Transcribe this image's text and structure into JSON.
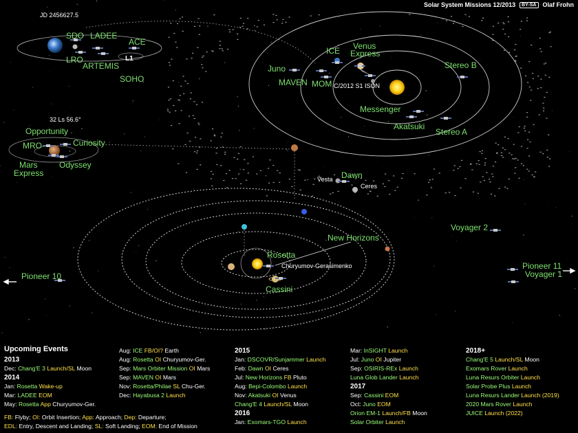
{
  "header": {
    "title": "Solar System Missions 12/2013",
    "license": "BY-SA",
    "author": "Olaf Frohn"
  },
  "earth_panel": {
    "julian_date": "JD 2456627.5",
    "labels": [
      "SDO",
      "LADEE",
      "LRO",
      "ARTEMIS",
      "ACE",
      "L1",
      "SOHO"
    ]
  },
  "mars_panel": {
    "martian_date": "32 Ls 56.6°",
    "labels": [
      "Opportunity",
      "MRO",
      "Curiosity",
      "Mars",
      "Express",
      "Odyssey"
    ]
  },
  "inner_labels": {
    "juno": "Juno",
    "ice": "ICE",
    "venus_express": [
      "Venus",
      "Express"
    ],
    "stereo_b": "Stereo B",
    "maven": "MAVEN",
    "mom": "MOM",
    "ison": "C/2012 S1 ISON",
    "messenger": "Messenger",
    "akatsuki": "Akatsuki",
    "stereo_a": "Stereo A"
  },
  "belt_labels": {
    "dawn": "Dawn",
    "vesta": "Vesta",
    "ceres": "Ceres"
  },
  "outer_labels": {
    "voyager2": "Voyager 2",
    "new_horizons": "New Horizons",
    "rosetta": "Rosetta",
    "cg": "Churyumov-Gerasimenko",
    "cassini": "Cassini",
    "pioneer10": "Pioneer 10",
    "pioneer11": "Pioneer 11",
    "voyager1": "Voyager 1"
  },
  "events": {
    "title": "Upcoming Events",
    "col1": [
      {
        "h": "2013"
      },
      {
        "d": "Dec:",
        "t": "Chang'E 3",
        "a": "Launch/SL",
        "s": "Moon"
      },
      {
        "h": "2014"
      },
      {
        "d": "Jan:",
        "t": "Rosetta",
        "a": "Wake-up",
        "s": ""
      },
      {
        "d": "Mar:",
        "t": "LADEE",
        "a": "EOM",
        "s": ""
      },
      {
        "d": "May:",
        "t": "Rosetta",
        "a": "App",
        "s": "Churyumov-Ger."
      }
    ],
    "col2": [
      {
        "d": "Aug:",
        "t": "ICE",
        "a": "FB/OI?",
        "s": "Earth"
      },
      {
        "d": "Aug:",
        "t": "Rosetta",
        "a": "OI",
        "s": "Churyumov-Ger."
      },
      {
        "d": "Sep:",
        "t": "Mars Orbiter Mission",
        "a": "OI",
        "s": "Mars"
      },
      {
        "d": "Sep:",
        "t": "MAVEN",
        "a": "OI",
        "s": "Mars"
      },
      {
        "d": "Nov:",
        "t": "Rosetta/Philae",
        "a": "SL",
        "s": "Chu-Ger."
      },
      {
        "d": "Dec:",
        "t": "Hayabusa 2",
        "a": "Launch",
        "s": ""
      }
    ],
    "col3": [
      {
        "h": "2015"
      },
      {
        "d": "Jan:",
        "t": "DSCOVR/Sunjammer",
        "a": "Launch",
        "s": ""
      },
      {
        "d": "Feb:",
        "t": "Dawn",
        "a": "OI",
        "s": "Ceres"
      },
      {
        "d": "Jul:",
        "t": "New Horizons",
        "a": "FB",
        "s": "Pluto"
      },
      {
        "d": "Aug:",
        "t": "Bepi-Colombo",
        "a": "Launch",
        "s": ""
      },
      {
        "d": "Nov:",
        "t": "Akatsuki",
        "a": "OI",
        "s": "Venus"
      },
      {
        "d": "",
        "t": "Chang'E 4",
        "a": "Launch/SL",
        "s": "Moon"
      },
      {
        "h": "2016"
      },
      {
        "d": "Jan:",
        "t": "Exomars-TGO",
        "a": "Launch",
        "s": ""
      }
    ],
    "col4": [
      {
        "d": "Mar:",
        "t": "InSIGHT",
        "a": "Launch",
        "s": ""
      },
      {
        "d": "Jul:",
        "t": "Juno",
        "a": "OI",
        "s": "Jupiter"
      },
      {
        "d": "Sep:",
        "t": "OSIRIS-REx",
        "a": "Launch",
        "s": ""
      },
      {
        "d": "",
        "t": "Luna Glob Lander",
        "a": "Launch",
        "s": ""
      },
      {
        "h": "2017"
      },
      {
        "d": "Sep:",
        "t": "Cassini",
        "a": "EOM",
        "s": ""
      },
      {
        "d": "Oct:",
        "t": "Juno",
        "a": "EOM",
        "s": ""
      },
      {
        "d": "",
        "t": "Orion EM-1",
        "a": "Launch/FB",
        "s": "Moon"
      },
      {
        "d": "",
        "t": "Solar Orbiter",
        "a": "Launch",
        "s": ""
      }
    ],
    "col5": [
      {
        "h": "2018+"
      },
      {
        "d": "",
        "t": "Chang'E 5",
        "a": "Launch/SL",
        "s": "Moon"
      },
      {
        "d": "",
        "t": "Exomars Rover",
        "a": "Launch",
        "s": ""
      },
      {
        "d": "",
        "t": "Luna Resurs Orbiter",
        "a": "Launch",
        "s": ""
      },
      {
        "d": "",
        "t": "Solar Probe Plus",
        "a": "Launch",
        "s": ""
      },
      {
        "d": "",
        "t": "Luna Resurs Lander",
        "a": "Launch (2019)",
        "s": ""
      },
      {
        "d": "",
        "t": "2020 Mars Rover",
        "a": "Launch",
        "s": ""
      },
      {
        "d": "",
        "t": "JUICE",
        "a": "Launch (2022)",
        "s": ""
      }
    ],
    "legend": [
      [
        "FB:",
        " Flyby; ",
        "OI:",
        " Orbit Insertion; ",
        "App:",
        " Approach; ",
        "Dep:",
        " Departure;"
      ],
      [
        "EDL:",
        " Entry, Descent and Landing; ",
        "SL:",
        " Soft Landing; ",
        "EOM:",
        " End of Mission"
      ]
    ]
  }
}
